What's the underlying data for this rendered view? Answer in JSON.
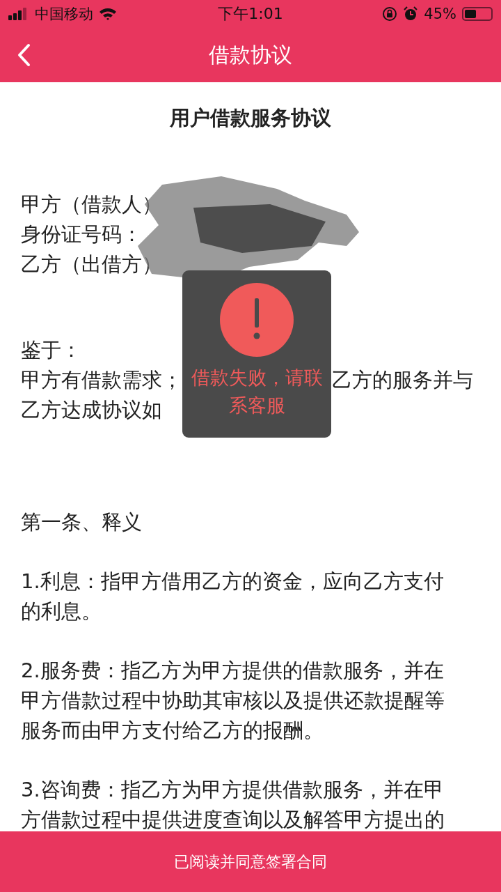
{
  "status_bar": {
    "carrier": "中国移动",
    "time": "下午1:01",
    "battery": "45%",
    "level": 0.45
  },
  "nav_bar": {
    "title": "借款协议"
  },
  "document": {
    "title": "用户借款服务协议",
    "blocks": [
      {
        "kind": "parties",
        "lines": [
          "甲方（借款人）",
          "身份证号码：",
          "乙方（出借方）"
        ]
      },
      {
        "kind": "preamble",
        "lines": [
          "鉴于：",
          [
            "甲方有借款需求；",
            "乙方的服务并与"
          ],
          "乙方达成协议如"
        ]
      },
      {
        "kind": "heading",
        "lines": [
          "第一条、释义"
        ]
      },
      {
        "kind": "clause",
        "lines": [
          "1.利息：指甲方借用乙方的资金，应向乙方支付",
          "的利息。"
        ]
      },
      {
        "kind": "clause",
        "lines": [
          "2.服务费：指乙方为甲方提供的借款服务，并在",
          "甲方借款过程中协助其审核以及提供还款提醒等",
          "服务而由甲方支付给乙方的报酬。"
        ]
      },
      {
        "kind": "clause",
        "lines": [
          "3.咨询费：指乙方为甲方提供借款服务，并在甲",
          "方借款过程中提供进度查询以及解答甲方提出的"
        ]
      }
    ]
  },
  "toast": {
    "message": "借款失败，请联系客服"
  },
  "footer_button": {
    "label": "已阅读并同意签署合同"
  }
}
